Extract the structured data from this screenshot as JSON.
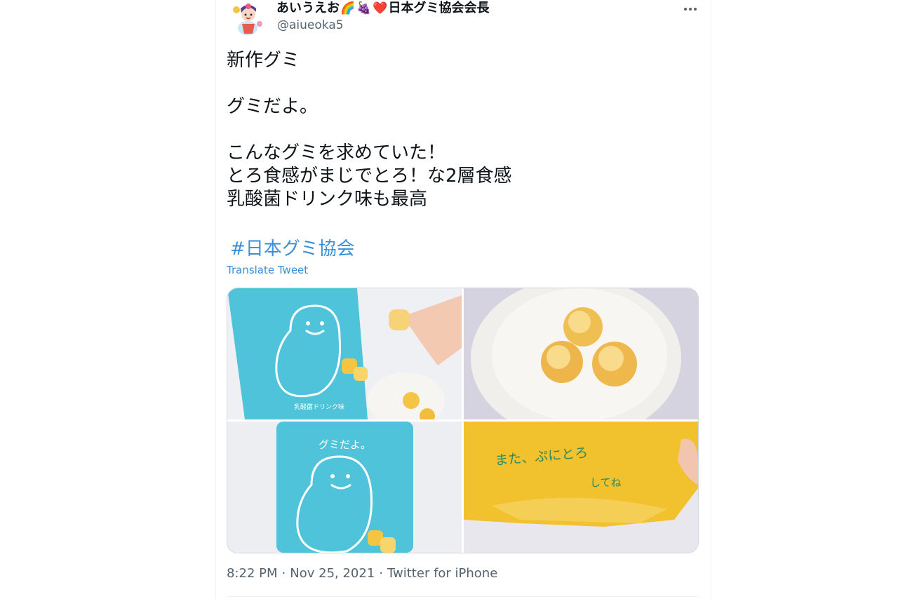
{
  "tweet": {
    "display_name": "あいうえお",
    "display_name_suffix": "日本グミ協会会長",
    "emojis": [
      "🌈",
      "🍇",
      "❤️"
    ],
    "handle": "@aiueoka5",
    "more_icon": "more-horizontal-icon",
    "text_lines": [
      "新作グミ",
      "",
      "グミだよ。",
      "",
      "こんなグミを求めていた！",
      "とろ食感がまじでとろ！な2層食感",
      "乳酸菌ドリンク味も最高"
    ],
    "hashtag": "#日本グミ協会",
    "translate_label": "Translate Tweet",
    "media": {
      "photo_1_text": "乳酸菌ドリンク味",
      "photo_3_text": "グミだよ。",
      "photo_4_text_1": "また、ぷにとろ",
      "photo_4_text_2": "してね"
    },
    "time": "8:22 PM",
    "date": "Nov 25, 2021",
    "source": "Twitter for iPhone",
    "separator": "·"
  },
  "colors": {
    "link": "#3a8fd6",
    "secondary_text": "#536471",
    "package_blue": "#4fc3d9",
    "gummy_yellow": "#f4c542",
    "bag_yellow": "#f2c12e"
  }
}
